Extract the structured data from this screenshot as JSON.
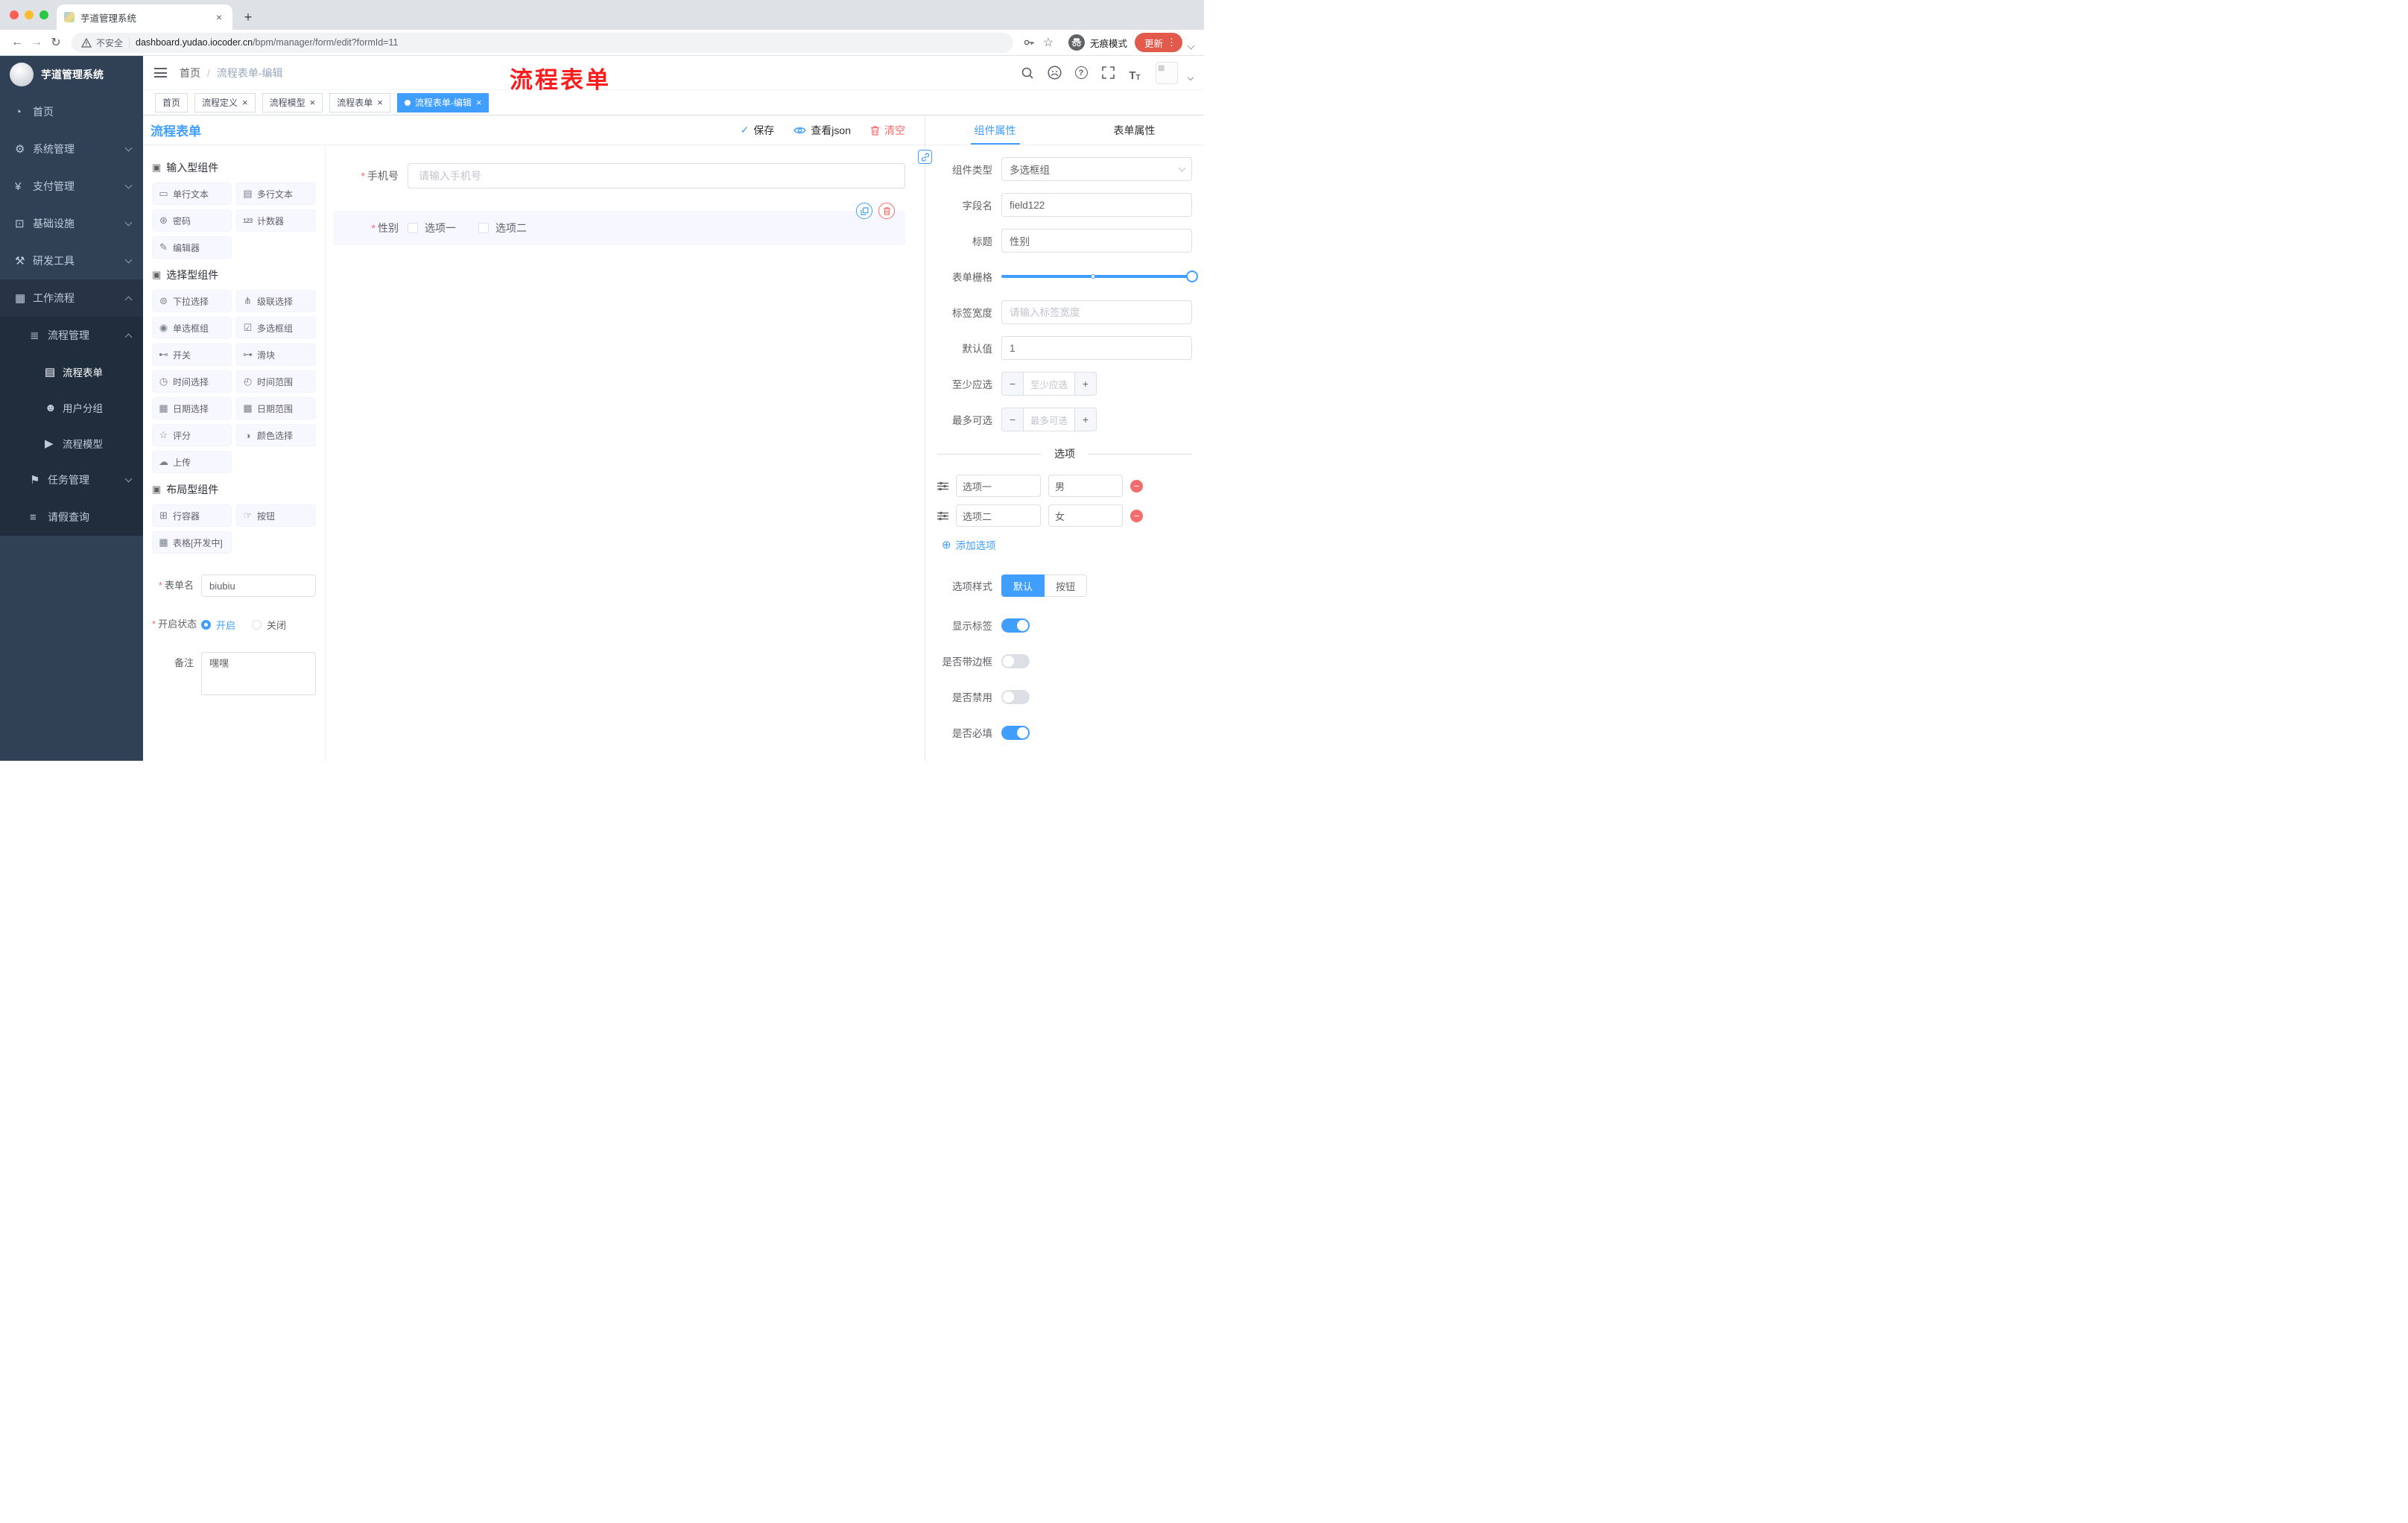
{
  "browser": {
    "tab_title": "芋道管理系统",
    "new_tab": "+",
    "close_tab": "×",
    "back": "←",
    "forward": "→",
    "reload": "↻",
    "security_label": "不安全",
    "url_host": "dashboard.yudao.iocoder.cn",
    "url_path": "/bpm/manager/form/edit?formId=11",
    "star": "☆",
    "incognito_label": "无痕模式",
    "update_label": "更新",
    "kebab": "⋮"
  },
  "annotation": {
    "text": "流程表单"
  },
  "sidebar": {
    "logo_title": "芋道管理系统",
    "items": [
      {
        "label": "首页"
      },
      {
        "label": "系统管理"
      },
      {
        "label": "支付管理"
      },
      {
        "label": "基础设施"
      },
      {
        "label": "研发工具"
      },
      {
        "label": "工作流程"
      },
      {
        "label": "流程管理"
      },
      {
        "label": "流程表单"
      },
      {
        "label": "用户分组"
      },
      {
        "label": "流程模型"
      },
      {
        "label": "任务管理"
      },
      {
        "label": "请假查询"
      }
    ]
  },
  "header": {
    "breadcrumb_home": "首页",
    "breadcrumb_sep": "/",
    "breadcrumb_current": "流程表单-编辑"
  },
  "tags": [
    {
      "label": "首页"
    },
    {
      "label": "流程定义"
    },
    {
      "label": "流程模型"
    },
    {
      "label": "流程表单"
    },
    {
      "label": "流程表单-编辑"
    }
  ],
  "editor": {
    "title": "流程表单",
    "actions": {
      "save": "保存",
      "view_json": "查看json",
      "clear": "清空"
    },
    "palette": {
      "groups": [
        {
          "title": "输入型组件",
          "items": [
            "单行文本",
            "多行文本",
            "密码",
            "计数器",
            "编辑器"
          ]
        },
        {
          "title": "选择型组件",
          "items": [
            "下拉选择",
            "级联选择",
            "单选框组",
            "多选框组",
            "开关",
            "滑块",
            "时间选择",
            "时间范围",
            "日期选择",
            "日期范围",
            "评分",
            "颜色选择",
            "上传"
          ]
        },
        {
          "title": "布局型组件",
          "items": [
            "行容器",
            "按钮",
            "表格[开发中]"
          ]
        }
      ]
    },
    "meta_form": {
      "name_label": "表单名",
      "name_value": "biubiu",
      "status_label": "开启状态",
      "status_on": "开启",
      "status_off": "关闭",
      "remark_label": "备注",
      "remark_value": "嘿嘿"
    },
    "canvas": {
      "phone_label": "手机号",
      "phone_placeholder": "请输入手机号",
      "gender_label": "性别",
      "gender_options": [
        "选项一",
        "选项二"
      ]
    }
  },
  "props": {
    "tabs": [
      "组件属性",
      "表单属性"
    ],
    "component_type_label": "组件类型",
    "component_type_value": "多选框组",
    "field_name_label": "字段名",
    "field_name_value": "field122",
    "title_label": "标题",
    "title_value": "性别",
    "grid_label": "表单栅格",
    "label_width_label": "标签宽度",
    "label_width_placeholder": "请输入标签宽度",
    "default_label": "默认值",
    "default_value": "1",
    "min_select_label": "至少应选",
    "min_select_placeholder": "至少应选",
    "max_select_label": "最多可选",
    "max_select_placeholder": "最多可选",
    "options_divider": "选项",
    "options": [
      {
        "label": "选项一",
        "value": "男"
      },
      {
        "label": "选项二",
        "value": "女"
      }
    ],
    "add_option": "添加选项",
    "option_style_label": "选项样式",
    "option_style_choices": [
      "默认",
      "按钮"
    ],
    "switches": [
      {
        "label": "显示标签",
        "on": true
      },
      {
        "label": "是否带边框",
        "on": false
      },
      {
        "label": "是否禁用",
        "on": false
      },
      {
        "label": "是否必填",
        "on": true
      }
    ]
  },
  "icons": {
    "home": "◔",
    "system": "⚙",
    "payment": "¥",
    "infra": "⊡",
    "devtools": "⚒",
    "workflow": "▦",
    "process_mgmt": "≣",
    "process_form": "▤",
    "user_group": "☻",
    "process_model": "▶",
    "task_mgmt": "⚑",
    "leave": "≡",
    "grp": "▣",
    "single_text": "▭",
    "multi_text": "▤",
    "password": "⊛",
    "counter": "123",
    "editor": "✎",
    "select": "⊚",
    "cascader": "⋔",
    "radio_grp": "◉",
    "checkbox_grp": "☑",
    "switch": "⊷",
    "slider": "⊶",
    "time": "◷",
    "time_range": "◴",
    "date": "▦",
    "date_range": "▩",
    "rate": "☆",
    "color": "◑",
    "upload": "☁",
    "row": "⊞",
    "button": "☞",
    "table": "▦",
    "check": "✓",
    "add": "⊕",
    "minus": "−",
    "plus": "+",
    "dash": "−"
  },
  "colors": {
    "accent": "#409eff",
    "danger": "#f56c6c",
    "annotation": "#fd1c1c"
  }
}
